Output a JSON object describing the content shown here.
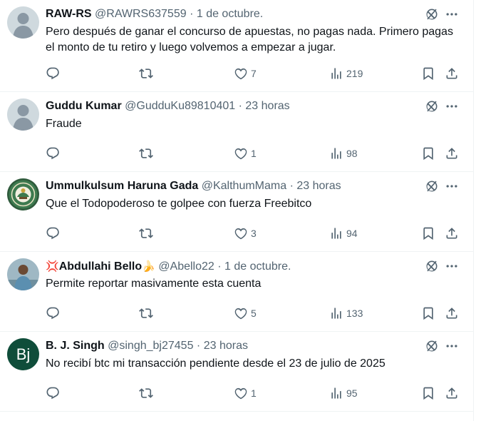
{
  "tweets": [
    {
      "name": "RAW-RS",
      "name_emoji_before": "",
      "name_emoji_after": "",
      "handle": "@RAWRS637559",
      "separator": "·",
      "time": "1 de octubre.",
      "text": "Pero después de ganar el concurso de apuestas, no pagas nada. Primero pagas el monto de tu retiro y luego volvemos a empezar a jugar.",
      "likes": "7",
      "views": "219",
      "avatar": "default-avatar"
    },
    {
      "name": "Guddu Kumar",
      "name_emoji_before": "",
      "name_emoji_after": "",
      "handle": "@GudduKu89810401",
      "separator": "·",
      "time": "23 horas",
      "text": "Fraude",
      "likes": "1",
      "views": "98",
      "avatar": "default-avatar"
    },
    {
      "name": "Ummulkulsum Haruna Gada",
      "name_emoji_before": "",
      "name_emoji_after": "",
      "handle": "@KalthumMama",
      "separator": "·",
      "time": "23 horas",
      "text": "Que el Todopoderoso te golpee con fuerza Freebitco",
      "likes": "3",
      "views": "94",
      "avatar": "emblem-avatar"
    },
    {
      "name": "Abdullahi Bello",
      "name_emoji_before": "💢",
      "name_emoji_after": "🍌",
      "handle": "@Abello22",
      "separator": "·",
      "time": "1 de octubre.",
      "text": "Permite reportar masivamente esta cuenta",
      "likes": "5",
      "views": "133",
      "avatar": "photo-avatar"
    },
    {
      "name": "B. J. Singh",
      "name_emoji_before": "",
      "name_emoji_after": "",
      "handle": "@singh_bj27455",
      "separator": "·",
      "time": "23 horas",
      "text": "No recibí btc mi transacción pendiente desde el 23 de julio de 2025",
      "likes": "1",
      "views": "95",
      "avatar": "letter-avatar",
      "avatar_letters": "Bj"
    }
  ],
  "icons": {
    "reply": "reply-icon",
    "retweet": "retweet-icon",
    "like": "heart-icon",
    "views": "views-icon",
    "bookmark": "bookmark-icon",
    "share": "share-icon",
    "grok": "grok-icon",
    "more": "more-icon"
  },
  "colors": {
    "text_primary": "#0f1419",
    "text_secondary": "#536471",
    "divider": "#eff3f4",
    "letter_avatar_bg": "#0f4d3a"
  }
}
